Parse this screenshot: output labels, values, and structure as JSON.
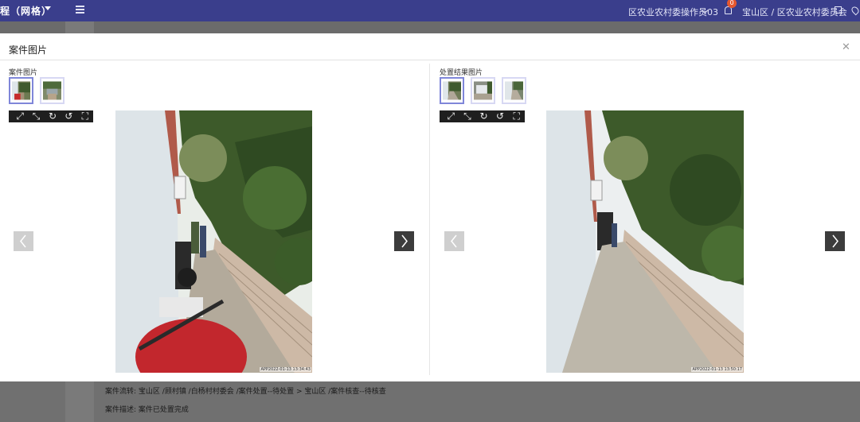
{
  "topbar": {
    "brand": "程（网格）",
    "user": "区农业农村委操作员03",
    "notification_count": "0",
    "org": "宝山区 / 区农业农村委员会"
  },
  "modal": {
    "title": "案件图片",
    "close_icon": "close-icon"
  },
  "left": {
    "label": "案件图片",
    "thumbnails": 2,
    "toolbar": [
      "expand-icon",
      "shrink-icon",
      "rotate-right-icon",
      "rotate-left-icon",
      "fullscreen-icon"
    ],
    "timestamp": "APP2022-01-13 13:34:43"
  },
  "right": {
    "label": "处置结果图片",
    "thumbnails": 3,
    "toolbar": [
      "expand-icon",
      "shrink-icon",
      "rotate-right-icon",
      "rotate-left-icon",
      "fullscreen-icon"
    ],
    "timestamp": "APP2022-01-13 13:50:17"
  },
  "footer": {
    "flow_label": "案件流转:",
    "flow_value": "宝山区 /顾村镇 /白杨村村委会 /案件处置--待处置 > 宝山区 /案件核查--待核查",
    "desc_label": "案件描述:",
    "desc_value": "案件已处置完成"
  },
  "colors": {
    "topbar": "#3a3e8c",
    "thumb_active_border": "#7f86d9",
    "nav_dark": "#3c3c3c",
    "nav_light": "#cfcfcf"
  }
}
